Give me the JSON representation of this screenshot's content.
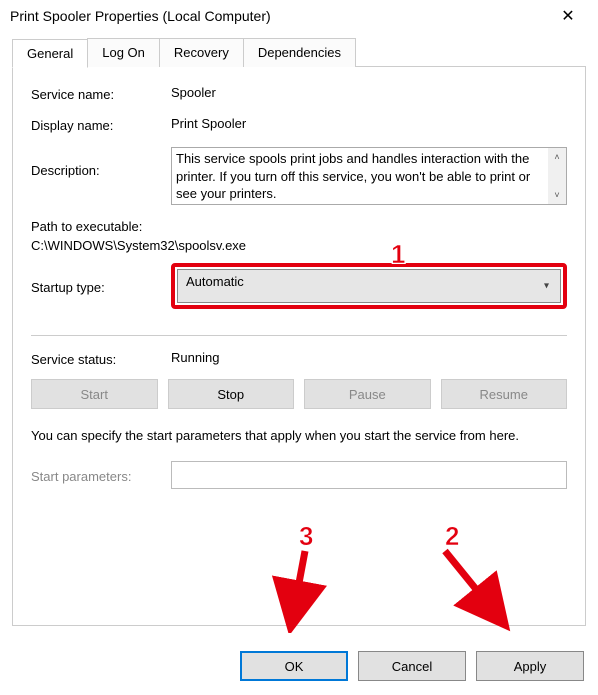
{
  "title": "Print Spooler Properties (Local Computer)",
  "tabs": [
    "General",
    "Log On",
    "Recovery",
    "Dependencies"
  ],
  "active_tab": 0,
  "fields": {
    "service_name_label": "Service name:",
    "service_name": "Spooler",
    "display_name_label": "Display name:",
    "display_name": "Print Spooler",
    "description_label": "Description:",
    "description": "This service spools print jobs and handles interaction with the printer.  If you turn off this service, you won't be able to print or see your printers.",
    "path_label": "Path to executable:",
    "path_value": "C:\\WINDOWS\\System32\\spoolsv.exe",
    "startup_label": "Startup type:",
    "startup_value": "Automatic",
    "status_label": "Service status:",
    "status_value": "Running",
    "hint": "You can specify the start parameters that apply when you start the service from here.",
    "params_label": "Start parameters:",
    "params_value": ""
  },
  "svc_buttons": {
    "start": "Start",
    "stop": "Stop",
    "pause": "Pause",
    "resume": "Resume"
  },
  "dlg_buttons": {
    "ok": "OK",
    "cancel": "Cancel",
    "apply": "Apply"
  },
  "annotations": {
    "n1": "1",
    "n2": "2",
    "n3": "3"
  },
  "colors": {
    "annotation_red": "#e3000f"
  }
}
